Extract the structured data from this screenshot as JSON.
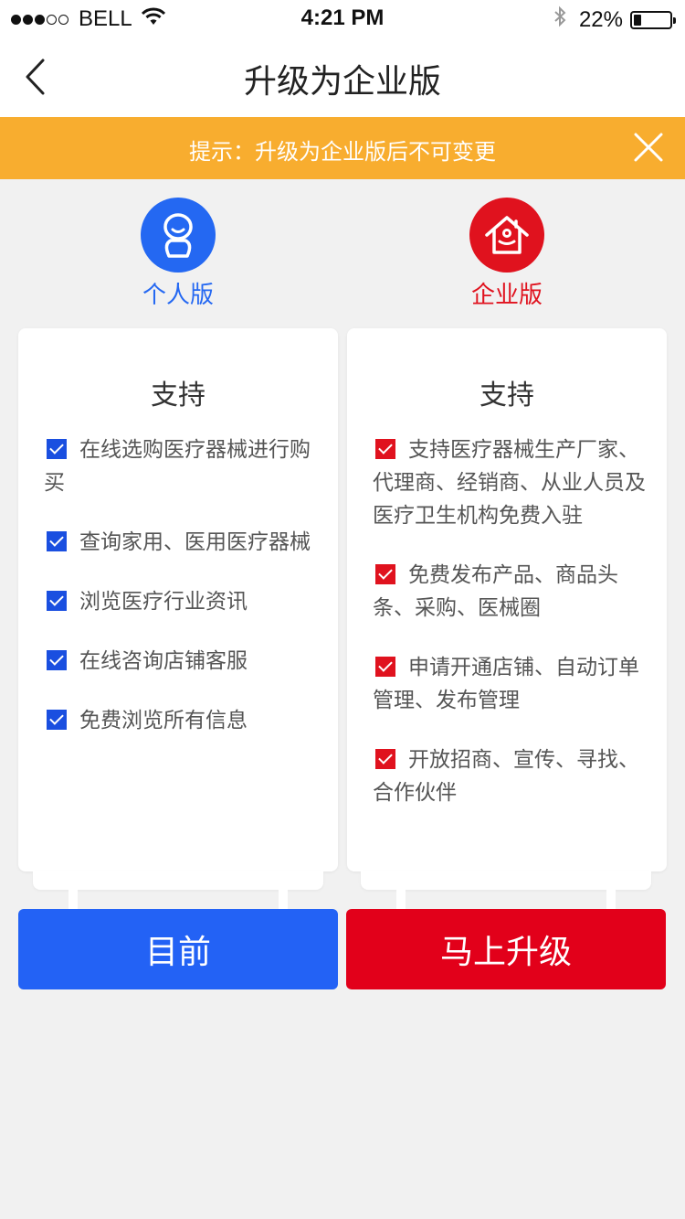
{
  "status_bar": {
    "carrier": "BELL",
    "time": "4:21 PM",
    "battery": "22%",
    "battery_level": 0.22
  },
  "nav": {
    "title": "升级为企业版",
    "back_icon": "chevron-left-icon"
  },
  "notice": {
    "text": "提示：升级为企业版后不可变更",
    "close_icon": "close-icon",
    "bg_color": "#f8ad2f"
  },
  "plans": {
    "personal": {
      "name": "个人版",
      "icon": "person-icon",
      "color": "#2468f2",
      "card_title": "支持",
      "features": [
        "在线选购医疗器械进行购买",
        "查询家用、医用医疗器械",
        "浏览医疗行业资讯",
        "在线咨询店铺客服",
        "免费浏览所有信息"
      ],
      "button": "目前"
    },
    "enterprise": {
      "name": "企业版",
      "icon": "house-icon",
      "color": "#e0121e",
      "card_title": "支持",
      "features": [
        "支持医疗器械生产厂家、代理商、经销商、从业人员及医疗卫生机构免费入驻",
        "免费发布产品、商品头条、采购、医械圈",
        "申请开通店铺、自动订单管理、发布管理",
        "开放招商、宣传、寻找、合作伙伴"
      ],
      "button": "马上升级"
    }
  }
}
